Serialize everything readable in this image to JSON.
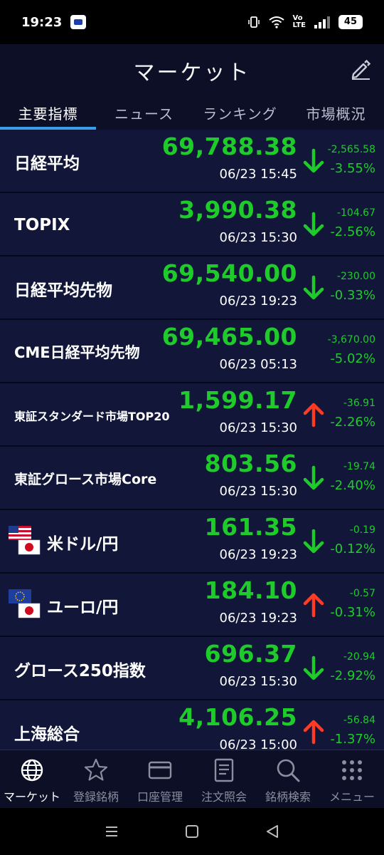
{
  "status": {
    "time": "19:23",
    "battery": "45",
    "volte": "Vo\nLTE"
  },
  "header": {
    "title": "マーケット"
  },
  "tabs": [
    {
      "label": "主要指標",
      "active": true
    },
    {
      "label": "ニュース",
      "active": false
    },
    {
      "label": "ランキング",
      "active": false
    },
    {
      "label": "市場概況",
      "active": false
    }
  ],
  "rows": [
    {
      "name": "日経平均",
      "price": "69,788.38",
      "time": "06/23 15:45",
      "change": "-2,565.58",
      "pct": "-3.55%",
      "dir": "down"
    },
    {
      "name": "TOPIX",
      "price": "3,990.38",
      "time": "06/23 15:30",
      "change": "-104.67",
      "pct": "-2.56%",
      "dir": "down"
    },
    {
      "name": "日経平均先物",
      "price": "69,540.00",
      "time": "06/23 19:23",
      "change": "-230.00",
      "pct": "-0.33%",
      "dir": "down"
    },
    {
      "name": "CME日経平均先物",
      "price": "69,465.00",
      "time": "06/23 05:13",
      "change": "-3,670.00",
      "pct": "-5.02%",
      "dir": "none"
    },
    {
      "name": "東証スタンダード市場TOP20",
      "price": "1,599.17",
      "time": "06/23 15:30",
      "change": "-36.91",
      "pct": "-2.26%",
      "dir": "up"
    },
    {
      "name": "東証グロース市場Core",
      "price": "803.56",
      "time": "06/23 15:30",
      "change": "-19.74",
      "pct": "-2.40%",
      "dir": "down"
    },
    {
      "name": "米ドル/円",
      "price": "161.35",
      "time": "06/23 19:23",
      "change": "-0.19",
      "pct": "-0.12%",
      "dir": "down",
      "flag": "us-jp"
    },
    {
      "name": "ユーロ/円",
      "price": "184.10",
      "time": "06/23 19:23",
      "change": "-0.57",
      "pct": "-0.31%",
      "dir": "up",
      "flag": "eu-jp"
    },
    {
      "name": "グロース250指数",
      "price": "696.37",
      "time": "06/23 15:30",
      "change": "-20.94",
      "pct": "-2.92%",
      "dir": "down"
    },
    {
      "name": "上海総合",
      "price": "4,106.25",
      "time": "06/23 15:00",
      "change": "-56.84",
      "pct": "-1.37%",
      "dir": "up"
    }
  ],
  "nav": [
    {
      "label": "マーケット",
      "icon": "globe-icon",
      "active": true
    },
    {
      "label": "登録銘柄",
      "icon": "star-icon",
      "active": false
    },
    {
      "label": "口座管理",
      "icon": "card-icon",
      "active": false
    },
    {
      "label": "注文照会",
      "icon": "document-icon",
      "active": false
    },
    {
      "label": "銘柄検索",
      "icon": "search-icon",
      "active": false
    },
    {
      "label": "メニュー",
      "icon": "grid-menu-icon",
      "active": false
    }
  ],
  "colors": {
    "green": "#1ecb2a",
    "red": "#ff3b24",
    "accent": "#3a9ee8",
    "background": "#0c0f26"
  }
}
